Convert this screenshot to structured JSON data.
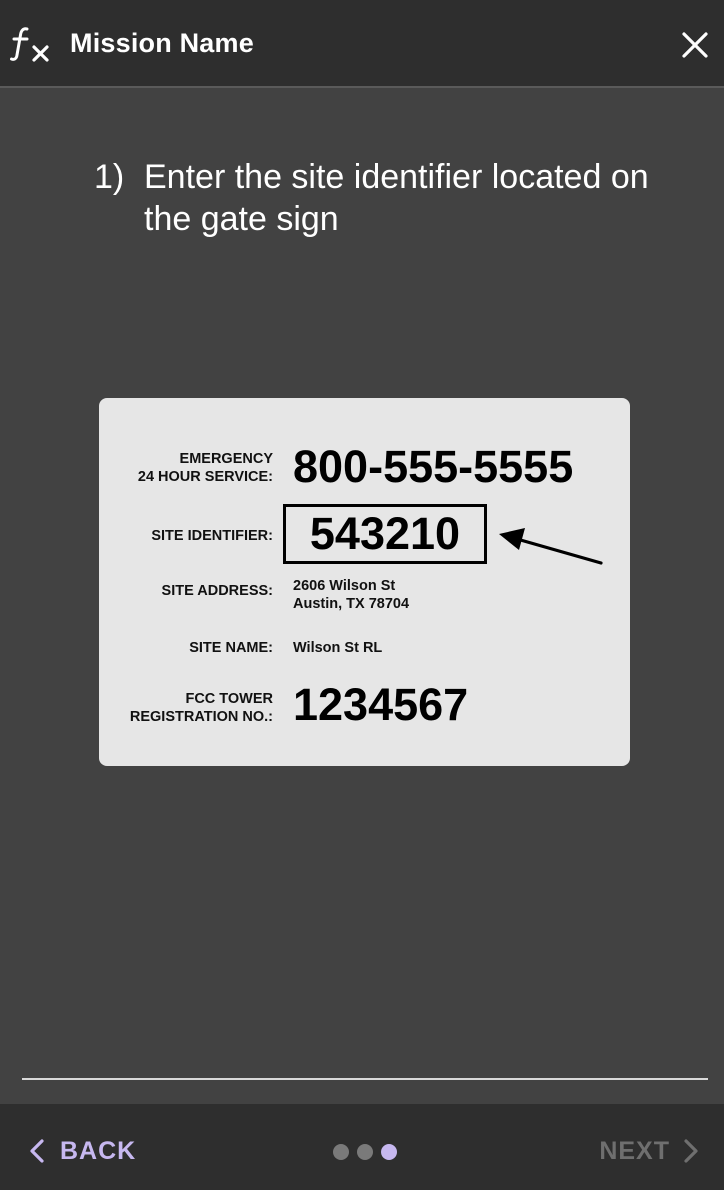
{
  "header": {
    "title": "Mission Name",
    "app_icon": "fx-icon",
    "close_icon": "close-icon"
  },
  "instruction": {
    "step_number": "1)",
    "text": "Enter the site identifier located on the gate sign"
  },
  "sign": {
    "emergency_label_1": "EMERGENCY",
    "emergency_label_2": "24 HOUR SERVICE:",
    "emergency_phone": "800-555-5555",
    "site_identifier_label": "SITE IDENTIFIER:",
    "site_identifier_value": "543210",
    "site_address_label": "SITE ADDRESS:",
    "site_address_line1": "2606 Wilson St",
    "site_address_line2": "Austin, TX 78704",
    "site_name_label": "SITE NAME:",
    "site_name_value": "Wilson St RL",
    "fcc_label_1": "FCC TOWER",
    "fcc_label_2": "REGISTRATION NO.:",
    "fcc_value": "1234567"
  },
  "footer": {
    "back_label": "BACK",
    "next_label": "NEXT",
    "pagination": {
      "total": 3,
      "active_index": 2
    }
  },
  "colors": {
    "accent": "#c7b8f0",
    "background": "#424242",
    "bar": "#2e2e2e",
    "disabled": "#6f6f6f",
    "sign_bg": "#e6e6e6"
  }
}
